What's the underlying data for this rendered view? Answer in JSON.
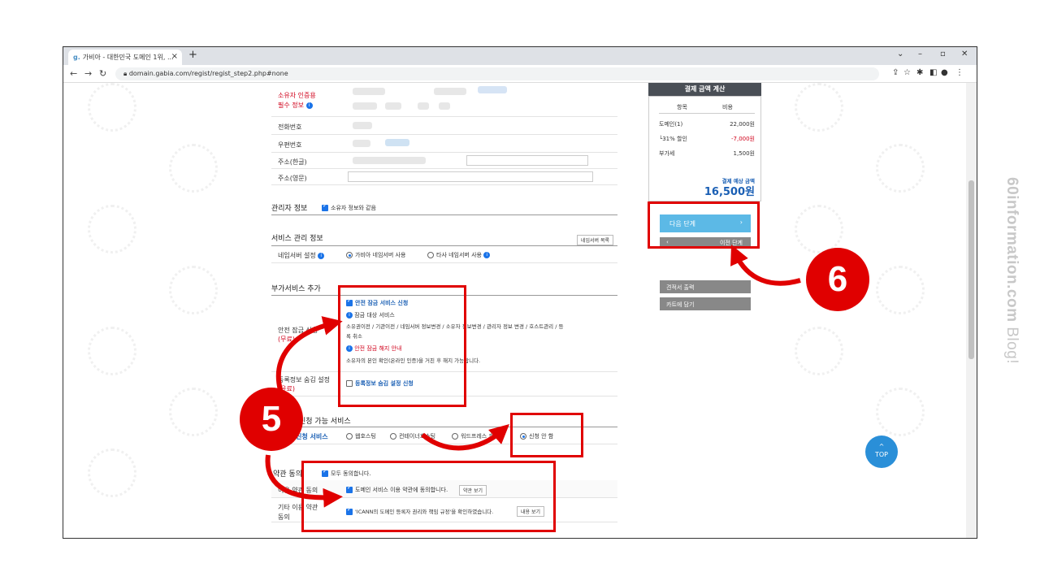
{
  "browser": {
    "tab_title": "가비아 - 대한민국 도메인 1위, ...",
    "tab_close": "×",
    "favicon": "g.",
    "new_tab": "+",
    "url": "domain.gabia.com/regist/regist_step2.php#none",
    "window_controls": [
      "⌄",
      "–",
      "▫",
      "✕"
    ]
  },
  "owner_section": {
    "auth_label_line1": "소유자 인증용",
    "auth_label_line2": "필수 정보",
    "phone_label": "전화번호",
    "postal_label": "우편번호",
    "address_kr_label": "주소(한글)",
    "address_en_label": "주소(영문)"
  },
  "admin_section": {
    "title": "관리자 정보",
    "same_as_owner": "소유자 정보와 같음"
  },
  "service_section": {
    "title": "서비스 관리 정보",
    "ns_list_button": "네임서버 목록",
    "ns_label": "네임서버 설정",
    "ns_option_gabia": "가비아 네임서버 사용",
    "ns_option_other": "타사 네임서버 사용"
  },
  "addon_section": {
    "title": "부가서비스 추가",
    "lock_label_line1": "안전 잠금 신청",
    "lock_label_line2": "(무료)",
    "lock_apply": "안전 잠금 서비스 신청",
    "lock_target_title": "잠금 대상 서비스",
    "lock_target_desc1": "소유권이전 / 기관이전 / 네임서버 정보변경 / 소유자 정보변경 / 관리자 정보 변경 / 호스트관리 / 등",
    "lock_target_desc2": "록 취소",
    "lock_release_title": "안전 잠금 해지 안내",
    "lock_release_desc": "소유자의 본인 확인(온라인 인증)을 거친 후 해지 가능합니다.",
    "privacy_label_line1": "등록정보 숨김 설정",
    "privacy_label_line2": "(유료)",
    "privacy_apply": "등록정보 숨김 설정 신청"
  },
  "linked_section": {
    "title": "신청 가능 서비스",
    "row_label": "신청 서비스",
    "options": [
      "웹호스팅",
      "컨테이너호스팅",
      "워드프레스 호스팅",
      "신청 안 함"
    ]
  },
  "terms_section": {
    "title": "약관 동의",
    "agree_all": "모두 동의합니다.",
    "terms_label": "이용 약관 동의",
    "terms_text": "도메인 서비스 이용 약관에 동의합니다.",
    "terms_button": "약관 보기",
    "other_label_line1": "기타 이용 약관",
    "other_label_line2": "동의",
    "other_text": "'ICANN의 도메인 등록자 권리와 책임 규정'을 확인하였습니다.",
    "other_button": "내용 보기"
  },
  "sidebar": {
    "header": "결제 금액 계산",
    "col_item": "항목",
    "col_cost": "비용",
    "rows": [
      {
        "label": "도메인(1)",
        "value": "22,000원"
      },
      {
        "label": "└31% 할인",
        "value": "-7,000원"
      },
      {
        "label": "부가세",
        "value": "1,500원"
      }
    ],
    "expected_label": "결제 예상 금액",
    "expected_value": "16,500원",
    "next_button": "다음 단계",
    "next_arrow": "›",
    "prev_button": "이전 단계",
    "prev_arrow": "‹",
    "quote_button": "견적서 출력",
    "cart_button": "카트에 담기"
  },
  "annotations": {
    "badge5": "5",
    "badge6": "6",
    "color": "#e00000"
  },
  "top_button": {
    "arrow": "^",
    "label": "TOP"
  },
  "watermark": {
    "bold": "60information.com",
    "light": " Blog!"
  }
}
